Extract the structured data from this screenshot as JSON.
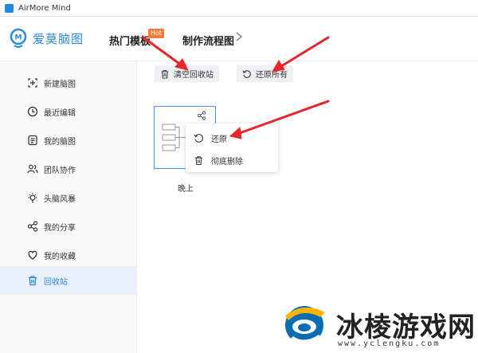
{
  "window": {
    "title": "AirMore Mind"
  },
  "header": {
    "logo_text": "爱莫脑图",
    "nav_hot_templates": "热门模板",
    "hot_badge": "Hot",
    "nav_flow": "制作流程图"
  },
  "sidebar": {
    "items": [
      {
        "label": "新建脑图",
        "icon": "plus-square-icon"
      },
      {
        "label": "最近编辑",
        "icon": "clock-icon"
      },
      {
        "label": "我的脑图",
        "icon": "document-list-icon"
      },
      {
        "label": "团队协作",
        "icon": "team-icon"
      },
      {
        "label": "头脑风暴",
        "icon": "lightbulb-icon"
      },
      {
        "label": "我的分享",
        "icon": "share-icon"
      },
      {
        "label": "我的收藏",
        "icon": "heart-icon"
      },
      {
        "label": "回收站",
        "icon": "trash-icon",
        "active": true
      }
    ]
  },
  "toolbar": {
    "clear_trash": "清空回收站",
    "restore_all": "还原所有"
  },
  "card": {
    "caption": "晚上"
  },
  "context_menu": {
    "restore": "还原",
    "delete_permanently": "彻底删除"
  },
  "watermark": {
    "title": "冰棱游戏网",
    "url": "www.yclengku.com"
  },
  "colors": {
    "accent": "#2b8ad9",
    "hot": "#f47b3c",
    "arrow": "#e8262a"
  }
}
